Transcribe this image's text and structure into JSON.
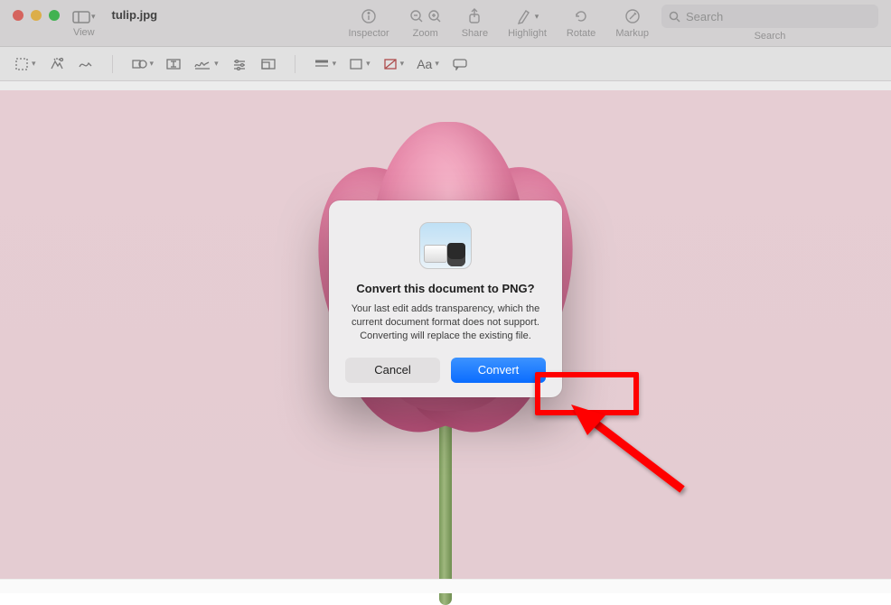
{
  "window": {
    "filename": "tulip.jpg",
    "view_menu_label": "View"
  },
  "toolbar_top": {
    "inspector": "Inspector",
    "zoom": "Zoom",
    "share": "Share",
    "highlight": "Highlight",
    "rotate": "Rotate",
    "markup": "Markup",
    "search_placeholder": "Search",
    "search_label": "Search"
  },
  "markup_toolbar": {
    "text_style_label": "Aa"
  },
  "dialog": {
    "title": "Convert this document to PNG?",
    "message": "Your last edit adds transparency, which the current document format does not support. Converting will replace the existing file.",
    "cancel": "Cancel",
    "convert": "Convert"
  },
  "colors": {
    "accent": "#0a6cff",
    "annotation": "#ff0000"
  }
}
